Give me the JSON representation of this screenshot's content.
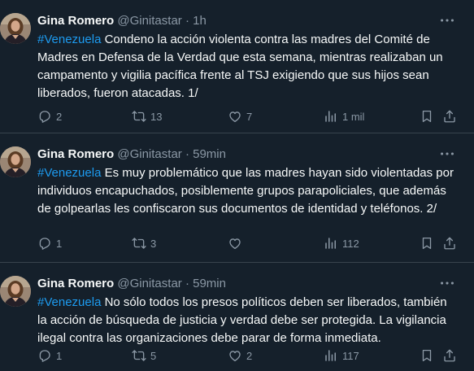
{
  "tweets": [
    {
      "author_name": "Gina Romero",
      "handle": "@Ginitastar",
      "separator": "·",
      "time": "1h",
      "hashtag": "#Venezuela",
      "text": " Condeno la acción violenta contra las madres del Comité de Madres en Defensa de la Verdad que esta semana, mientras realizaban un campamento y vigilia pacífica frente al TSJ exigiendo que sus hijos sean liberados, fueron atacadas. 1/",
      "replies": "2",
      "retweets": "13",
      "likes": "7",
      "views": "1 mil"
    },
    {
      "author_name": "Gina Romero",
      "handle": "@Ginitastar",
      "separator": "·",
      "time": "59min",
      "hashtag": "#Venezuela",
      "text": " Es muy problemático que las madres hayan sido violentadas por individuos encapuchados, posiblemente grupos parapoliciales, que además de golpearlas les confiscaron sus documentos de identidad y teléfonos. 2/",
      "replies": "1",
      "retweets": "3",
      "likes": "",
      "views": "112"
    },
    {
      "author_name": "Gina Romero",
      "handle": "@Ginitastar",
      "separator": "·",
      "time": "59min",
      "hashtag": "#Venezuela",
      "text": " No sólo todos los presos políticos deben ser liberados, también la acción de búsqueda de justicia y verdad debe ser protegida. La vigilancia ilegal contra las organizaciones debe parar de forma inmediata.",
      "replies": "1",
      "retweets": "5",
      "likes": "2",
      "views": "117"
    }
  ],
  "icons": {
    "more": "more-dots-icon",
    "reply": "reply-icon",
    "retweet": "retweet-icon",
    "like": "heart-icon",
    "views": "views-icon",
    "bookmark": "bookmark-icon",
    "share": "share-icon"
  },
  "colors": {
    "background": "#15202b",
    "text": "#f7f9f9",
    "secondary": "#8b98a5",
    "link": "#1d9bf0",
    "divider": "#38444d"
  }
}
